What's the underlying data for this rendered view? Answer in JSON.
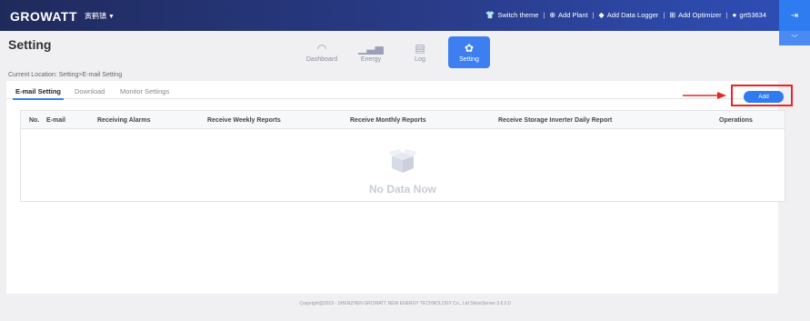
{
  "topbar": {
    "logo": "GROWATT",
    "plant_select": "寅鹤镇",
    "actions": [
      {
        "icon": "shirt-icon",
        "label": "Switch theme"
      },
      {
        "icon": "plus-circle-icon",
        "label": "Add Plant"
      },
      {
        "icon": "datalogger-icon",
        "label": "Add Data Logger"
      },
      {
        "icon": "optimizer-icon",
        "label": "Add Optimizer"
      },
      {
        "icon": "user-icon",
        "label": "grt53634"
      }
    ],
    "logout_icon": "logout-icon"
  },
  "header": {
    "title": "Setting",
    "location": "Current Location: Setting>E-mail Setting",
    "nav": [
      {
        "label": "Dashboard",
        "icon": "gauge-icon",
        "active": false
      },
      {
        "label": "Energy",
        "icon": "bar-chart-icon",
        "active": false
      },
      {
        "label": "Log",
        "icon": "document-icon",
        "active": false
      },
      {
        "label": "Setting",
        "icon": "gear-icon",
        "active": true
      }
    ]
  },
  "subtabs": [
    {
      "label": "E-mail Setting",
      "active": true
    },
    {
      "label": "Download",
      "active": false
    },
    {
      "label": "Monitor Settings",
      "active": false
    }
  ],
  "add_button": "Add",
  "table": {
    "columns": [
      "No.",
      "E-mail",
      "Receiving Alarms",
      "Receive Weekly Reports",
      "Receive Monthly Reports",
      "Receive Storage Inverter Daily Report",
      "Operations"
    ],
    "empty_text": "No Data Now"
  },
  "footer": "Copyright@2019 - SHENZHEN GROWATT NEW ENERGY TECHNOLOGY Co., Ltd ShineServer-3.6.0.0",
  "colors": {
    "accent": "#2f7bf0",
    "highlight": "#e8261f",
    "topbar": "#1f2a5c"
  }
}
